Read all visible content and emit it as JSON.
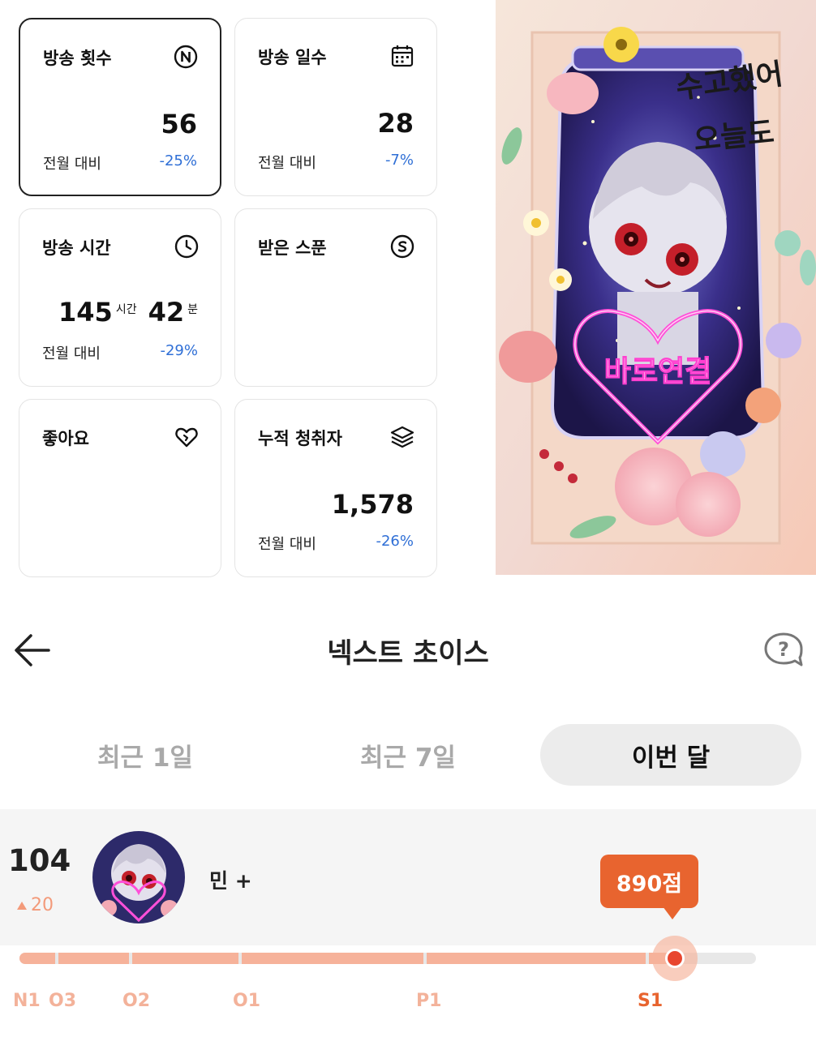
{
  "cards": [
    {
      "title": "방송 횟수",
      "icon": "n-circle-icon",
      "value": "56",
      "compare": "전월 대비",
      "delta": "-25%"
    },
    {
      "title": "방송 일수",
      "icon": "calendar-icon",
      "value": "28",
      "compare": "전월 대비",
      "delta": "-7%"
    },
    {
      "title": "방송 시간",
      "icon": "clock-icon",
      "hours": "145",
      "hours_unit": "시간",
      "minutes": "42",
      "minutes_unit": "분",
      "compare": "전월 대비",
      "delta": "-29%"
    },
    {
      "title": "받은 스푼",
      "icon": "spoon-coin-icon"
    },
    {
      "title": "좋아요",
      "icon": "heart-icon"
    },
    {
      "title": "누적 청취자",
      "icon": "layers-icon",
      "value": "1,578",
      "compare": "전월 대비",
      "delta": "-26%"
    }
  ],
  "artwork": {
    "icon": "stream-cover-artwork",
    "text_top": "수고했어",
    "text_bottom": "오늘도",
    "sign": "바로연결"
  },
  "header": {
    "title": "넥스트 초이스",
    "back_icon": "back-arrow-icon",
    "help_icon": "help-bubble-icon"
  },
  "tabs": [
    {
      "label": "최근 1일",
      "active": false
    },
    {
      "label": "최근 7일",
      "active": false
    },
    {
      "label": "이번 달",
      "active": true
    }
  ],
  "ranking": {
    "rank": "104",
    "change": "20",
    "change_icon": "triangle-up-icon",
    "name": "민 +",
    "score": "890점",
    "progress": 0.89,
    "tiers": [
      "N1",
      "O3",
      "O2",
      "O1",
      "P1",
      "S1"
    ],
    "current_tier": "S1"
  },
  "colors": {
    "accent": "#e8642f",
    "progress_fill": "#f6b29a",
    "delta_blue": "#2f6fd6",
    "tab_active_bg": "#ececec"
  }
}
